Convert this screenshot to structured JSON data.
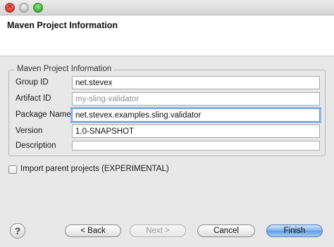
{
  "header": {
    "title": "Maven Project Information"
  },
  "group": {
    "label": "Maven Project Information",
    "fields": [
      {
        "label": "Group ID",
        "value": "net.stevex",
        "placeholder": ""
      },
      {
        "label": "Artifact ID",
        "value": "",
        "placeholder": "my-sling-validator"
      },
      {
        "label": "Package Name",
        "value": "net.stevex.examples.sling.validator",
        "placeholder": ""
      },
      {
        "label": "Version",
        "value": "1.0-SNAPSHOT",
        "placeholder": ""
      },
      {
        "label": "Description",
        "value": "",
        "placeholder": ""
      }
    ]
  },
  "options": {
    "import_parent_label": "Import parent projects (EXPERIMENTAL)",
    "import_parent_checked": false
  },
  "footer": {
    "help_glyph": "?",
    "back_label": "< Back",
    "next_label": "Next >",
    "cancel_label": "Cancel",
    "finish_label": "Finish"
  },
  "colors": {
    "focus_ring": "#8fb6ea",
    "default_button": "#5c9be3"
  }
}
